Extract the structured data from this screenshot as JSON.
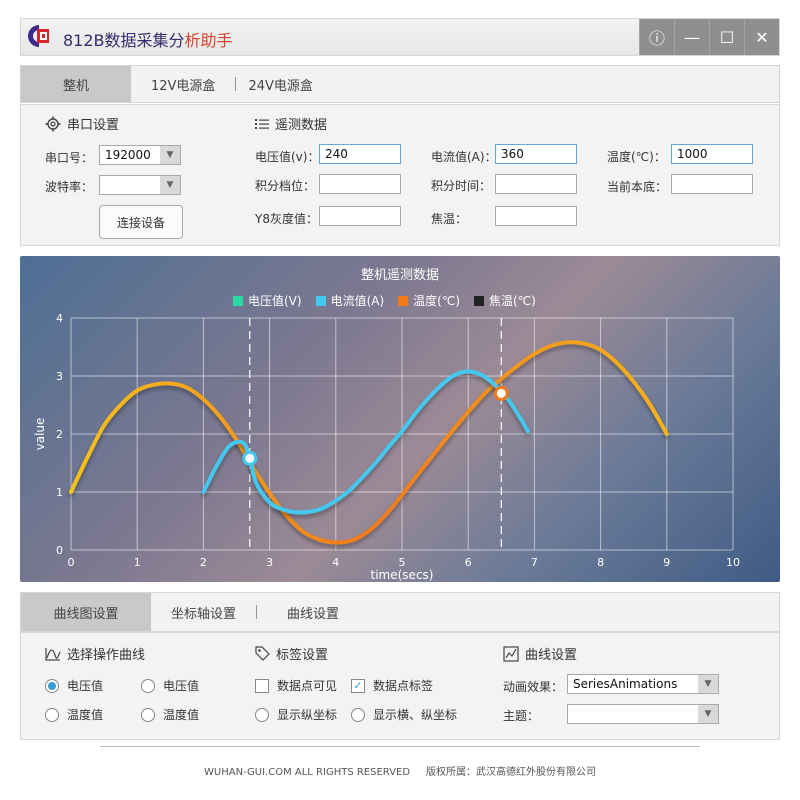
{
  "app": {
    "title_prefix": "812B数据采集分",
    "title_suffix": "析助手"
  },
  "window_controls": {
    "info": "ⓘ",
    "minimize": "—",
    "maximize": "☐",
    "close": "✕"
  },
  "top_tabs": [
    "整机",
    "12V电源盒",
    "24V电源盒"
  ],
  "serial": {
    "title": "串口设置",
    "port_label": "串口号：",
    "port_value": "192000",
    "baud_label": "波特率：",
    "baud_value": "",
    "connect_button": "连接设备"
  },
  "telemetry": {
    "title": "遥测数据",
    "voltage_label": "电压值(v)：",
    "voltage_value": "240",
    "current_label": "电流值(A)：",
    "current_value": "360",
    "temp_label": "温度(℃)：",
    "temp_value": "1000",
    "integral_level_label": "积分档位：",
    "integral_level_value": "",
    "integral_time_label": "积分时间：",
    "integral_time_value": "",
    "current_base_label": "当前本底：",
    "current_base_value": "",
    "y8_label": "Y8灰度值：",
    "y8_value": "",
    "focal_temp_label": "焦温：",
    "focal_temp_value": ""
  },
  "chart_data": {
    "type": "line",
    "title": "整机遥测数据",
    "xlabel": "time(secs)",
    "ylabel": "value",
    "xlim": [
      0,
      10
    ],
    "ylim": [
      0,
      4
    ],
    "x_ticks": [
      "0",
      "1",
      "2",
      "3",
      "4",
      "5",
      "6",
      "7",
      "8",
      "9",
      "10"
    ],
    "y_ticks": [
      "0",
      "1",
      "2",
      "3",
      "4"
    ],
    "grid": true,
    "legend_position": "top",
    "series": [
      {
        "name": "电压值(V)",
        "color": "#2bd9a4",
        "x": [],
        "y": []
      },
      {
        "name": "电流值(A)",
        "color": "#44c8f0",
        "x": [
          2.0,
          2.2,
          2.4,
          2.6,
          2.7,
          2.8,
          3.0,
          3.2,
          3.4,
          3.6,
          3.8,
          4.0,
          4.2,
          4.4,
          4.6,
          4.8,
          5.0,
          5.2,
          5.4,
          5.6,
          5.8,
          6.0,
          6.2,
          6.4,
          6.6,
          6.8,
          6.9
        ],
        "y": [
          1.0,
          1.45,
          1.8,
          1.85,
          1.58,
          1.15,
          0.82,
          0.7,
          0.65,
          0.66,
          0.72,
          0.85,
          1.02,
          1.25,
          1.5,
          1.78,
          2.05,
          2.35,
          2.62,
          2.85,
          3.02,
          3.08,
          3.02,
          2.85,
          2.6,
          2.25,
          2.05
        ]
      },
      {
        "name": "温度(℃)",
        "color": "#f0a21a",
        "x": [
          0.0,
          0.25,
          0.5,
          0.75,
          1.0,
          1.25,
          1.5,
          1.75,
          2.0,
          2.25,
          2.5,
          2.75,
          3.0,
          3.25,
          3.5,
          3.75,
          4.0,
          4.25,
          4.5,
          4.75,
          5.0,
          5.25,
          5.5,
          5.75,
          6.0,
          6.25,
          6.5,
          6.75,
          7.0,
          7.25,
          7.5,
          7.75,
          8.0,
          8.25,
          8.5,
          8.75,
          9.0
        ],
        "y": [
          1.0,
          1.6,
          2.15,
          2.5,
          2.75,
          2.85,
          2.87,
          2.8,
          2.6,
          2.3,
          1.9,
          1.42,
          0.98,
          0.6,
          0.32,
          0.18,
          0.13,
          0.17,
          0.33,
          0.6,
          0.95,
          1.32,
          1.68,
          2.04,
          2.38,
          2.7,
          2.95,
          3.18,
          3.38,
          3.52,
          3.58,
          3.56,
          3.45,
          3.22,
          2.9,
          2.5,
          2.0
        ]
      },
      {
        "name": "焦温(℃)",
        "color": "#222222",
        "x": [],
        "y": []
      }
    ],
    "markers": [
      {
        "x": 2.7,
        "y": 1.58,
        "color": "#44c8f0"
      },
      {
        "x": 6.5,
        "y": 2.7,
        "color": "#f07a1a"
      }
    ],
    "crosshairs_x": [
      2.7,
      6.5
    ]
  },
  "bottom_tabs": [
    "曲线图设置",
    "坐标轴设置",
    "曲线设置"
  ],
  "curve_select": {
    "title": "选择操作曲线",
    "options": [
      {
        "label": "电压值",
        "checked": true
      },
      {
        "label": "电压值",
        "checked": false
      },
      {
        "label": "温度值",
        "checked": false
      },
      {
        "label": "温度值",
        "checked": false
      }
    ]
  },
  "label_settings": {
    "title": "标签设置",
    "show_points": "数据点可见",
    "point_labels": "数据点标签",
    "show_y": "显示纵坐标",
    "show_xy": "显示横、纵坐标"
  },
  "curve_settings": {
    "title": "曲线设置",
    "anim_label": "动画效果：",
    "anim_value": "SeriesAnimations",
    "theme_label": "主题：",
    "theme_value": ""
  },
  "footer": {
    "left": "WUHAN-GUI.COM ALL RIGHTS RESERVED",
    "right": "版权所属：武汉高德红外股份有限公司"
  }
}
